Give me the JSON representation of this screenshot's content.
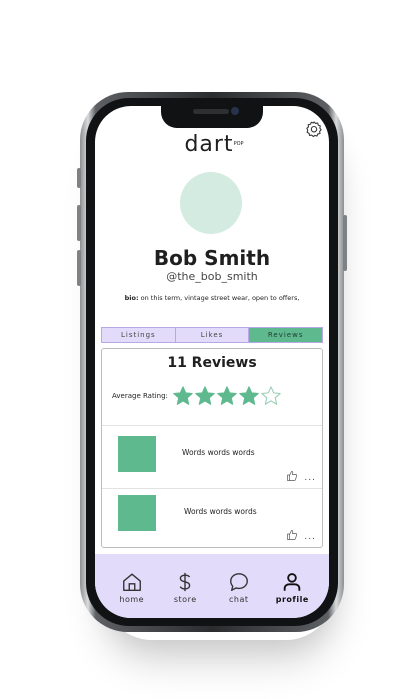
{
  "app": {
    "logo_text": "dart",
    "logo_tag": "POP"
  },
  "profile": {
    "name": "Bob Smith",
    "handle": "@the_bob_smith",
    "bio_label": "bio:",
    "bio_text": " on this term, vintage street wear, open to offers,"
  },
  "tabs": [
    {
      "label": "Listings",
      "active": false
    },
    {
      "label": "Likes",
      "active": false
    },
    {
      "label": "Reviews",
      "active": true
    }
  ],
  "reviews": {
    "title": "11 Reviews",
    "rating_label": "Average Rating:",
    "rating": 4,
    "rating_max": 5,
    "items": [
      {
        "text": "Words words words",
        "more": "..."
      },
      {
        "text": "Words words words",
        "more": "..."
      }
    ]
  },
  "nav": [
    {
      "label": "home",
      "icon": "home-icon",
      "active": false
    },
    {
      "label": "store",
      "icon": "dollar-icon",
      "active": false
    },
    {
      "label": "chat",
      "icon": "chat-bubble-icon",
      "active": false
    },
    {
      "label": "profile",
      "icon": "person-icon",
      "active": true
    }
  ],
  "colors": {
    "accent_green": "#5fb98f",
    "lavender": "#e2dbfa",
    "avatar_bg": "#d3ebe0"
  }
}
